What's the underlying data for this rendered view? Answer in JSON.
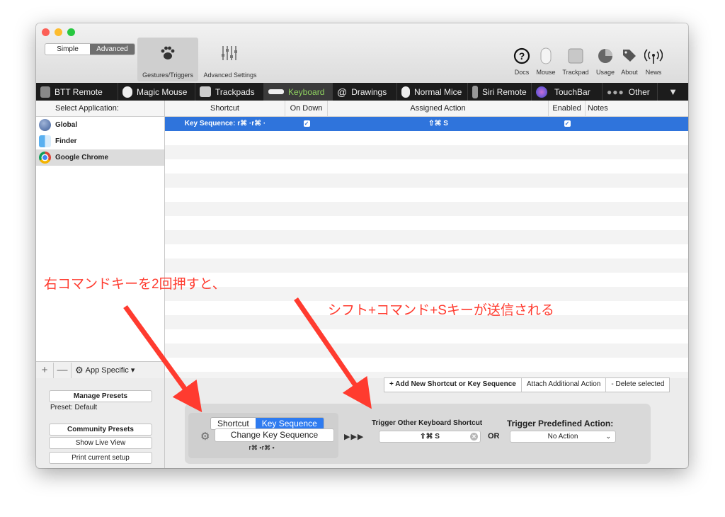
{
  "toolbar": {
    "mode_simple": "Simple",
    "mode_advanced": "Advanced",
    "gestures_label": "Gestures/Triggers",
    "advanced_label": "Advanced Settings",
    "right_icons": [
      {
        "label": "Docs",
        "icon": "question-circle-icon"
      },
      {
        "label": "Mouse",
        "icon": "mouse-icon"
      },
      {
        "label": "Trackpad",
        "icon": "trackpad-icon"
      },
      {
        "label": "Usage",
        "icon": "pie-chart-icon"
      },
      {
        "label": "About",
        "icon": "tags-icon"
      },
      {
        "label": "News",
        "icon": "antenna-icon"
      }
    ]
  },
  "tabs": [
    {
      "label": "BTT Remote"
    },
    {
      "label": "Magic Mouse"
    },
    {
      "label": "Trackpads"
    },
    {
      "label": "Keyboard",
      "active": true
    },
    {
      "label": "Drawings"
    },
    {
      "label": "Normal Mice"
    },
    {
      "label": "Siri Remote"
    },
    {
      "label": "TouchBar"
    },
    {
      "label": "Other"
    }
  ],
  "sidebar": {
    "header": "Select Application:",
    "apps": [
      {
        "name": "Global",
        "icon": "globe-icon"
      },
      {
        "name": "Finder",
        "icon": "finder-icon"
      },
      {
        "name": "Google Chrome",
        "icon": "chrome-icon",
        "selected": true
      }
    ],
    "add": "+",
    "remove": "—",
    "app_specific": "App Specific ▾"
  },
  "table": {
    "columns": [
      "Shortcut",
      "On Down",
      "Assigned Action",
      "Enabled",
      "Notes"
    ],
    "rows": [
      {
        "shortcut": "Key Sequence: r⌘ ·r⌘ ·",
        "on_down": "✓",
        "action": "⇧⌘ S",
        "enabled": "✓",
        "notes": ""
      }
    ]
  },
  "actions": {
    "add": "+ Add New Shortcut or Key Sequence",
    "attach": "Attach Additional Action",
    "delete": "- Delete selected"
  },
  "presets": {
    "manage": "Manage Presets",
    "current": "Preset: Default",
    "community": "Community Presets",
    "live_view": "Show Live View",
    "print": "Print current setup"
  },
  "config": {
    "tab_shortcut": "Shortcut",
    "tab_key_sequence": "Key Sequence",
    "change_button": "Change Key Sequence",
    "sequence_text": "r⌘ •r⌘ •",
    "arrows": "▶▶▶",
    "trigger_label": "Trigger Other Keyboard Shortcut",
    "trigger_value": "⇧⌘ S",
    "or": "OR",
    "predefined_label": "Trigger Predefined Action:",
    "predefined_value": "No Action"
  },
  "annotations": {
    "left": "右コマンドキーを2回押すと、",
    "right": "シフト+コマンド+Sキーが送信される",
    "color": "#ff3b2f"
  }
}
